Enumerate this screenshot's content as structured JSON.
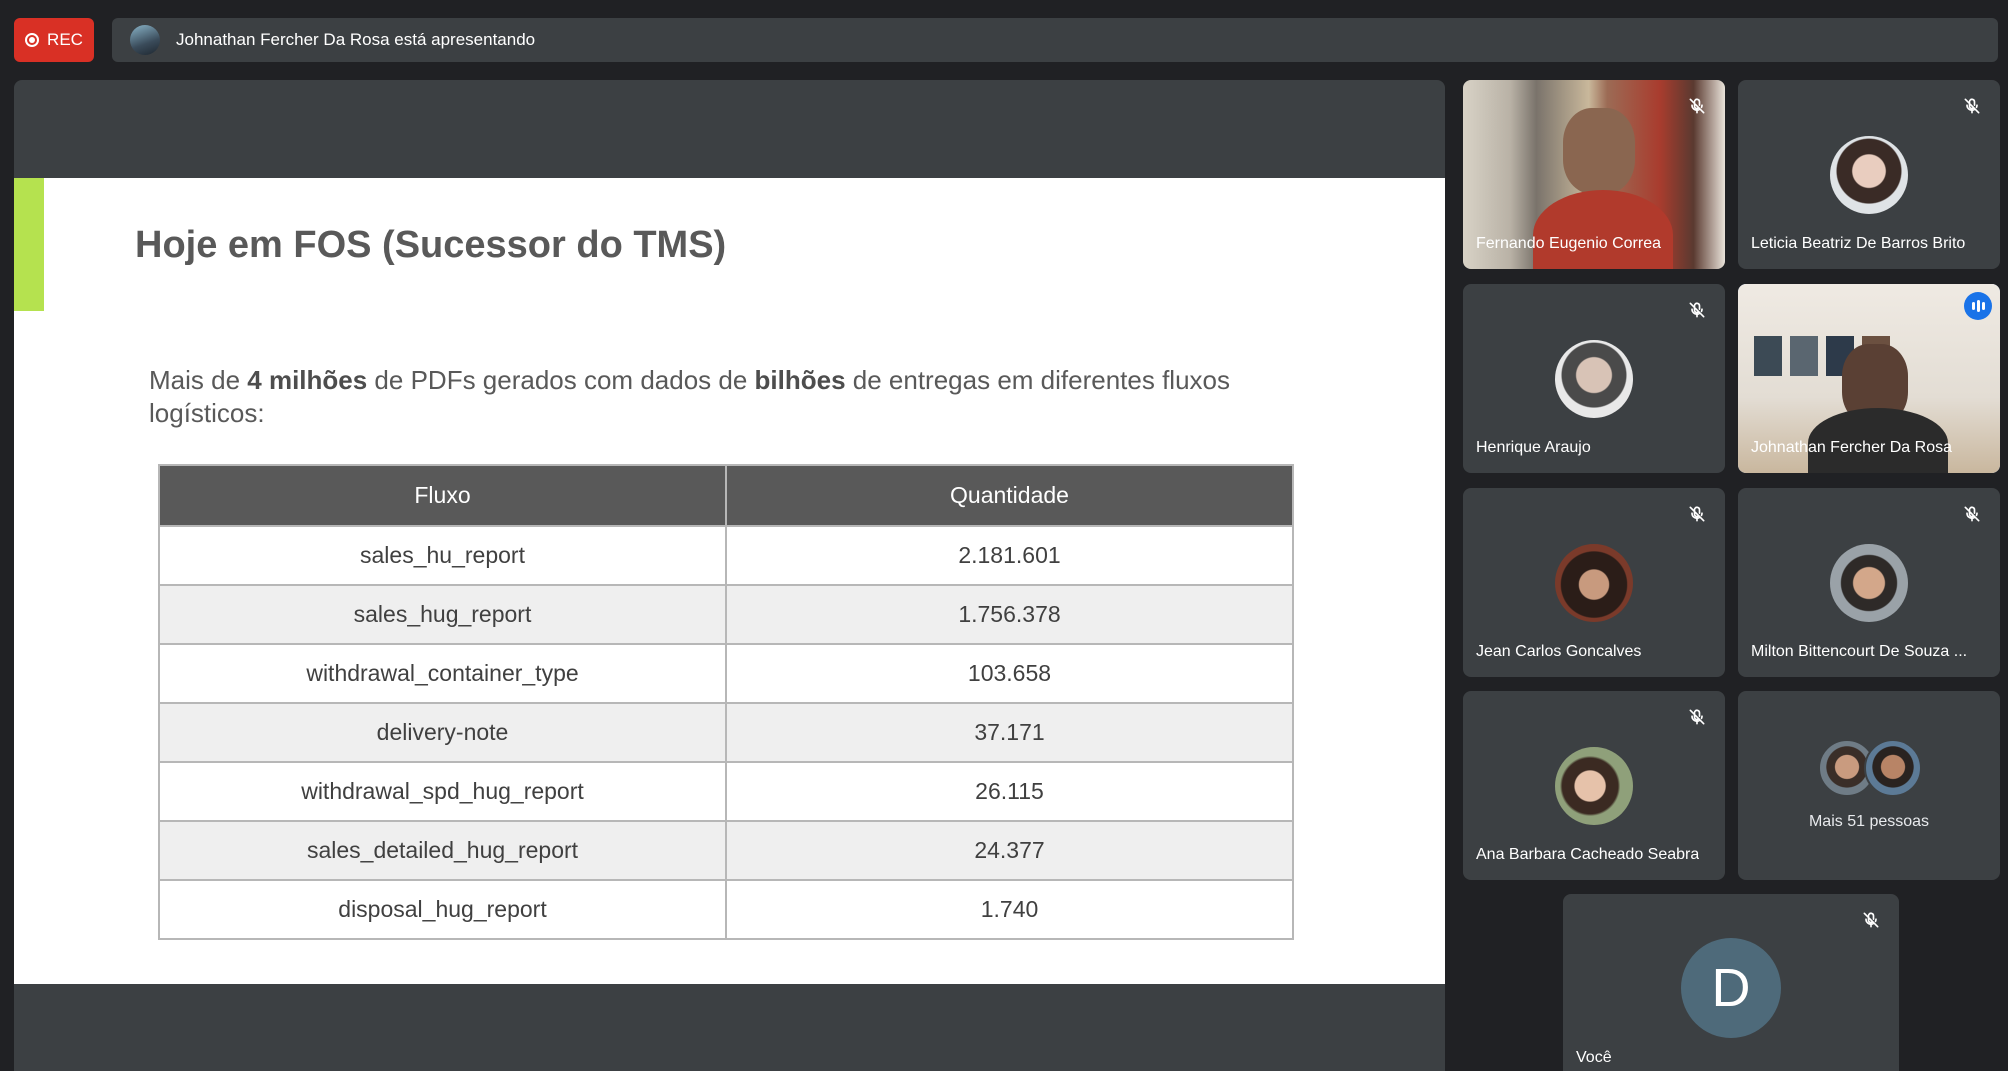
{
  "top_bar": {
    "rec_label": "REC",
    "presenting_text": "Johnathan Fercher Da Rosa está apresentando"
  },
  "slide": {
    "title": "Hoje em FOS (Sucessor do TMS)",
    "intro": {
      "p1": "Mais de ",
      "b1": "4 milhões",
      "p2": " de PDFs gerados com dados de ",
      "b2": "bilhões",
      "p3": " de entregas em diferentes fluxos logísticos:"
    },
    "table": {
      "headers": [
        "Fluxo",
        "Quantidade"
      ],
      "rows": [
        [
          "sales_hu_report",
          "2.181.601"
        ],
        [
          "sales_hug_report",
          "1.756.378"
        ],
        [
          "withdrawal_container_type",
          "103.658"
        ],
        [
          "delivery-note",
          "37.171"
        ],
        [
          "withdrawal_spd_hug_report",
          "26.115"
        ],
        [
          "sales_detailed_hug_report",
          "24.377"
        ],
        [
          "disposal_hug_report",
          "1.740"
        ]
      ]
    }
  },
  "participants": [
    {
      "name": "Fernando Eugenio Correa",
      "type": "video"
    },
    {
      "name": "Leticia Beatriz De Barros Brito",
      "type": "avatar"
    },
    {
      "name": "Henrique Araujo",
      "type": "avatar"
    },
    {
      "name": "Johnathan Fercher Da Rosa",
      "type": "video",
      "speaking": true
    },
    {
      "name": "Jean Carlos Goncalves",
      "type": "avatar"
    },
    {
      "name": "Milton Bittencourt De Souza ...",
      "type": "avatar"
    },
    {
      "name": "Ana Barbara Cacheado Seabra",
      "type": "avatar"
    }
  ],
  "more_people": "Mais 51 pessoas",
  "self_tile": {
    "name": "Você",
    "initial": "D"
  },
  "colors": {
    "rec": "#d93025",
    "tile_bg": "#3c4043",
    "active_border": "#8ab4f8",
    "slide_accent": "#b5e24f",
    "table_header": "#595959"
  }
}
